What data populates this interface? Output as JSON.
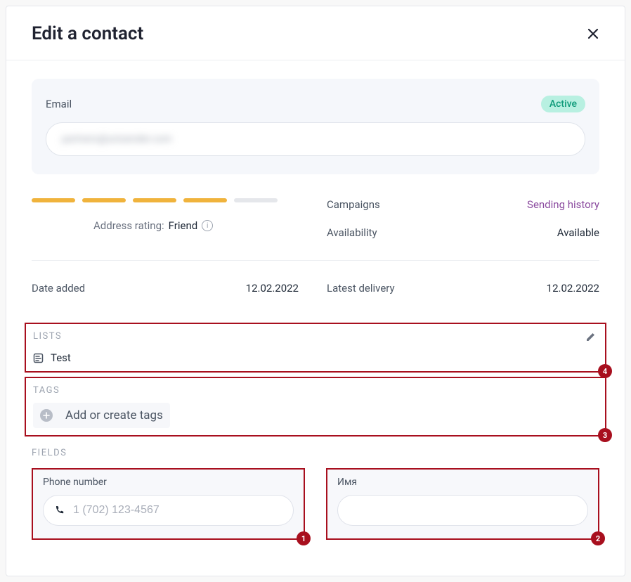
{
  "header": {
    "title": "Edit a contact"
  },
  "email": {
    "label": "Email",
    "status": "Active",
    "value_masked": "partners@unisender.com"
  },
  "rating": {
    "label": "Address rating:",
    "value": "Friend",
    "filled_bars": 4,
    "total_bars": 5
  },
  "stats": {
    "campaigns_label": "Campaigns",
    "sending_history": "Sending history",
    "availability_label": "Availability",
    "availability_value": "Available"
  },
  "dates": {
    "added_label": "Date added",
    "added_value": "12.02.2022",
    "latest_label": "Latest delivery",
    "latest_value": "12.02.2022"
  },
  "lists": {
    "title": "LISTS",
    "items": [
      {
        "name": "Test"
      }
    ]
  },
  "tags": {
    "title": "TAGS",
    "add_label": "Add or create tags"
  },
  "fields": {
    "title": "FIELDS",
    "phone": {
      "label": "Phone number",
      "placeholder": "1 (702) 123-4567"
    },
    "name": {
      "label": "Имя",
      "placeholder": ""
    }
  },
  "annot": {
    "phone": "1",
    "name": "2",
    "tags": "3",
    "lists": "4"
  }
}
